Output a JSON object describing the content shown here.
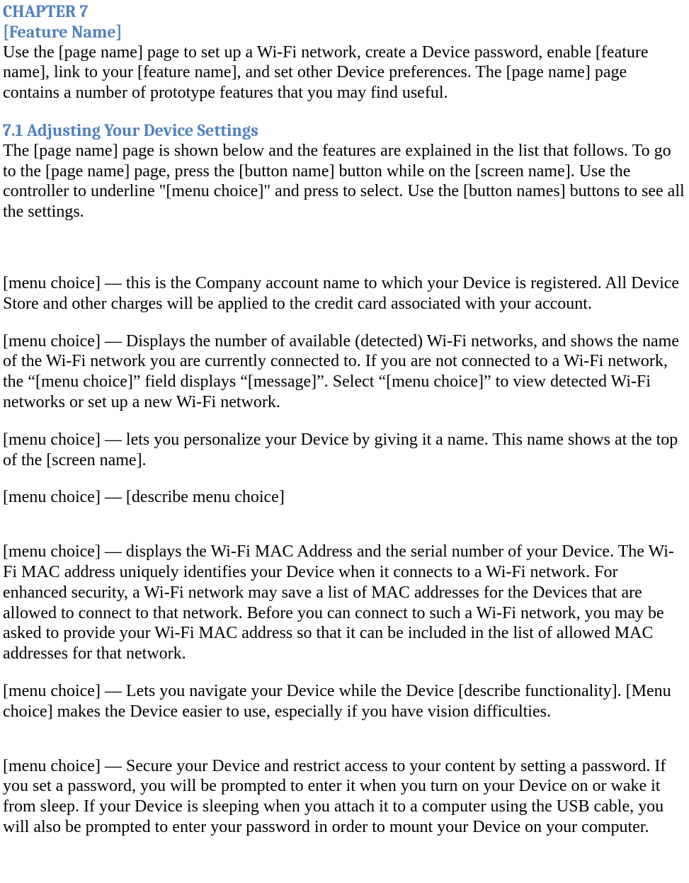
{
  "chapter_label": "CHAPTER 7",
  "feature_name": "[Feature Name]",
  "intro_para": "Use the [page name] page to set up a Wi-Fi network, create a Device password, enable [feature name], link to your [feature name], and set other Device preferences. The [page name] page contains a number of prototype features that you may find useful.",
  "section_heading": "7.1 Adjusting Your Device Settings",
  "section_intro": "The [page name] page is shown below and the features are explained in the list that follows. To go to the [page name] page, press the [button name] button while on the [screen name]. Use the controller to underline \"[menu choice]\" and press to select. Use the [button names] buttons to see all the settings.",
  "items": [
    "[menu choice] — this is the Company account name to which your Device is registered. All Device Store and other charges will be applied to the credit card associated with your account.",
    "[menu choice] — Displays the number of available (detected) Wi-Fi networks, and shows the name of the Wi-Fi network you are currently connected to. If you are not connected to a Wi-Fi network, the “[menu choice]” field displays “[message]”. Select “[menu choice]” to view detected Wi-Fi networks or set up a new Wi-Fi network.",
    "[menu choice] — lets you personalize your Device by giving it a name. This name shows at the top of the [screen name].",
    "[menu choice] — [describe menu choice]",
    "[menu choice] — displays the Wi-Fi MAC Address and the serial number of your Device. The Wi-Fi MAC address uniquely identifies your Device when it connects to a Wi-Fi network. For enhanced security, a Wi-Fi network may save a list of MAC addresses for the Devices that are allowed to connect to that network. Before you can connect to such a Wi-Fi network, you may be asked to provide your Wi-Fi MAC address so that it can be included in the list of allowed MAC addresses for that network.",
    "[menu choice] — Lets you navigate your Device while the Device [describe functionality]. [Menu choice] makes the Device easier to use, especially if you have vision difficulties.",
    "[menu choice] — Secure your Device and restrict access to your content by setting a password. If you set a password, you will be prompted to enter it when you turn on your Device on or wake it from sleep. If your Device is sleeping when you attach it to a computer using the USB cable, you will also be prompted to enter your password in order to mount your Device on your computer."
  ]
}
